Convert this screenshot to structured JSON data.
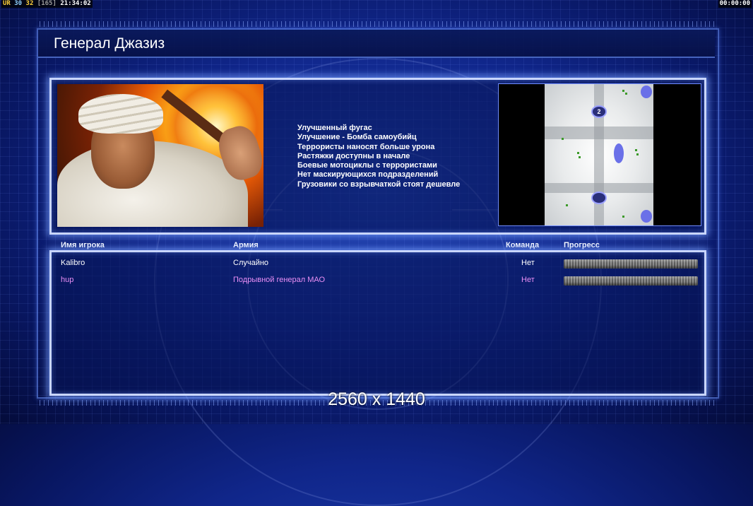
{
  "hud": {
    "left_ur": "UR",
    "left_n1": "30",
    "left_n2": "32",
    "left_bracket": "[165]",
    "left_time": "21:34:02",
    "right_time": "00:00:00"
  },
  "title": "Генерал Джазиз",
  "description": [
    "Улучшенный фугас",
    "Улучшение - Бомба самоубийц",
    "Террористы наносят больше урона",
    "Растяжки доступны в начале",
    "Боевые мотоциклы с террористами",
    "Нет маскирующихся подразделений",
    "Грузовики со взрывчаткой стоят дешевле"
  ],
  "minimap": {
    "start_marker": "2"
  },
  "table": {
    "headers": {
      "player": "Имя игрока",
      "army": "Армия",
      "team": "Команда",
      "progress": "Прогресс"
    },
    "rows": [
      {
        "player": "Kalibro",
        "army": "Случайно",
        "team": "Нет",
        "color": "#ffffff"
      },
      {
        "player": "hup",
        "army": "Подрывной генерал МАО",
        "team": "Нет",
        "color": "#e98ff5"
      }
    ]
  },
  "overlay_resolution": "2560 x 1440",
  "colors": {
    "accent_border": "#c9d6ff",
    "player2": "#e98ff5"
  }
}
